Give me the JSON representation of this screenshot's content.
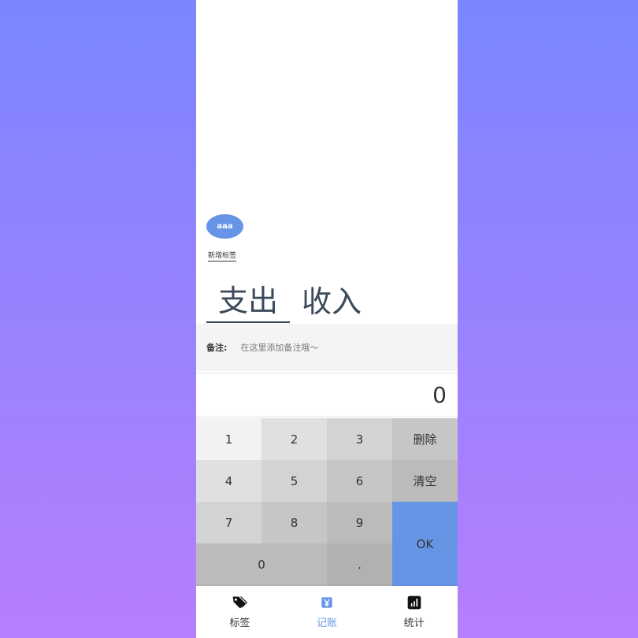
{
  "tags": [
    "aaa"
  ],
  "add_tag_label": "新增标签",
  "type_tabs": [
    {
      "label": "支出",
      "selected": true
    },
    {
      "label": "收入",
      "selected": false
    }
  ],
  "notes": {
    "label": "备注:",
    "placeholder": "在这里添加备注哦～",
    "value": ""
  },
  "amount": "0",
  "keypad": {
    "k1": "1",
    "k2": "2",
    "k3": "3",
    "delete": "删除",
    "k4": "4",
    "k5": "5",
    "k6": "6",
    "clear": "清空",
    "k7": "7",
    "k8": "8",
    "k9": "9",
    "ok": "OK",
    "k0": "0",
    "dot": "."
  },
  "nav": [
    {
      "label": "标签",
      "icon": "tag-icon",
      "active": false
    },
    {
      "label": "记账",
      "icon": "money-icon",
      "active": true
    },
    {
      "label": "统计",
      "icon": "chart-icon",
      "active": false
    }
  ],
  "colors": {
    "accent": "#6795e6",
    "text": "#3c4a5c",
    "bg_top": "#7a86fe",
    "bg_bottom": "#b67efe"
  }
}
